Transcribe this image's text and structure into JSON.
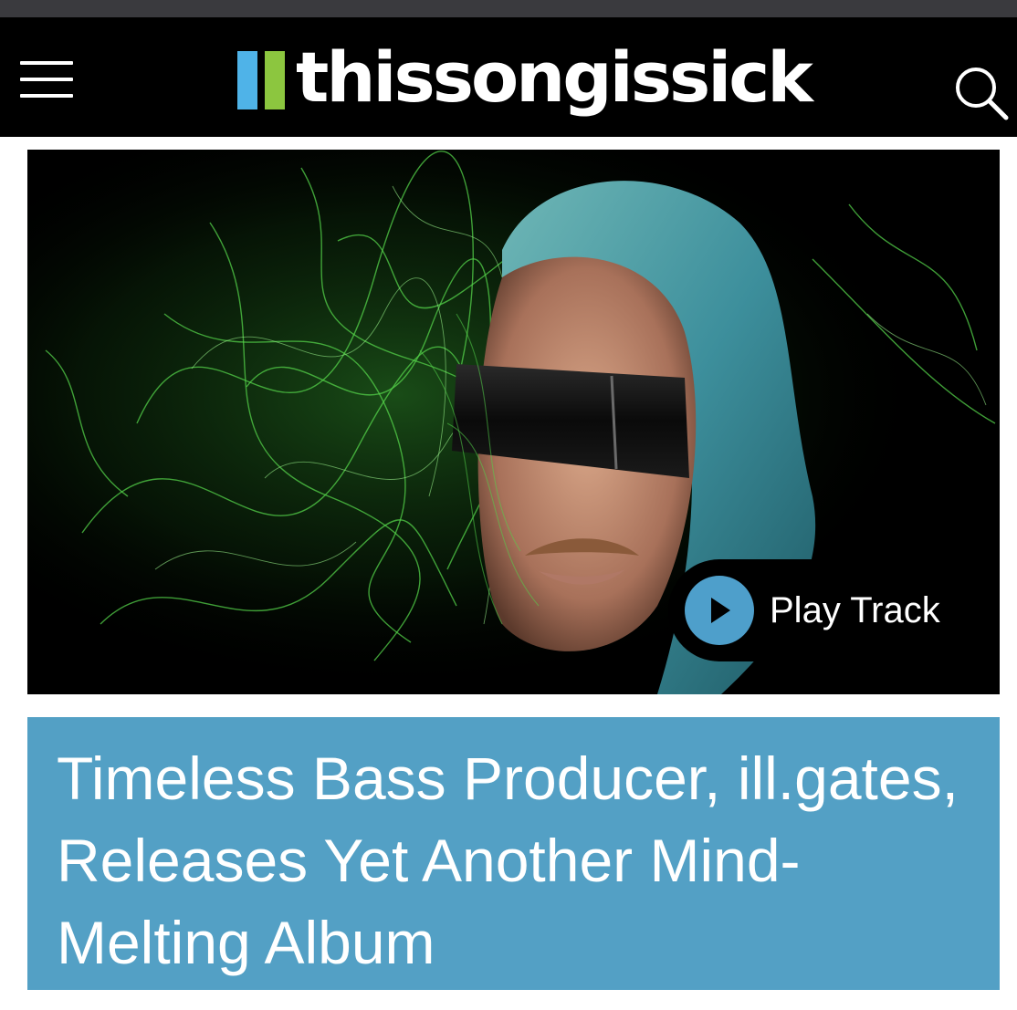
{
  "site": {
    "name": "thissongissick",
    "logo_bar_colors": [
      "#4fb3e8",
      "#8cc63f"
    ],
    "menu_icon": "hamburger-menu-icon",
    "search_icon": "search-icon"
  },
  "hero": {
    "image_alt": "Portrait of ill.gates with blue hair and dark visor glasses surrounded by green light trails",
    "play_label": "Play Track",
    "play_icon": "play-icon",
    "accent_color": "#4e9fcb"
  },
  "article": {
    "title": "Timeless Bass Producer, ill.gates, Releases Yet Another Mind-Melting Album",
    "title_background": "#53a0c5"
  }
}
